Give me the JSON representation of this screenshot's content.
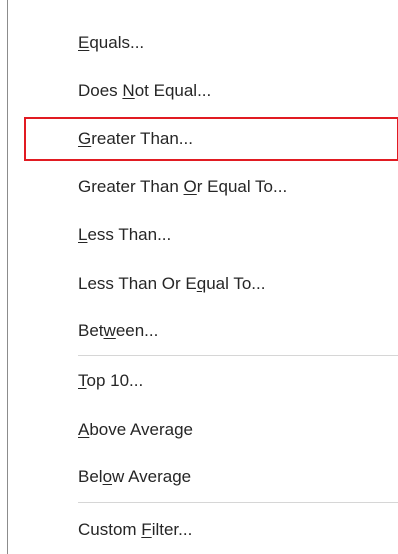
{
  "menu": {
    "items": [
      {
        "pre": "",
        "u": "E",
        "post": "quals..."
      },
      {
        "pre": "Does ",
        "u": "N",
        "post": "ot Equal..."
      },
      {
        "pre": "",
        "u": "G",
        "post": "reater Than..."
      },
      {
        "pre": "Greater Than ",
        "u": "O",
        "post": "r Equal To..."
      },
      {
        "pre": "",
        "u": "L",
        "post": "ess Than..."
      },
      {
        "pre": "Less Than Or E",
        "u": "q",
        "post": "ual To..."
      },
      {
        "pre": "Bet",
        "u": "w",
        "post": "een..."
      },
      {
        "pre": "",
        "u": "T",
        "post": "op 10..."
      },
      {
        "pre": "",
        "u": "A",
        "post": "bove Average"
      },
      {
        "pre": "Bel",
        "u": "o",
        "post": "w Average"
      },
      {
        "pre": "Custom ",
        "u": "F",
        "post": "ilter..."
      }
    ],
    "highlighted_index": 2,
    "highlight_color": "#e11b22"
  }
}
